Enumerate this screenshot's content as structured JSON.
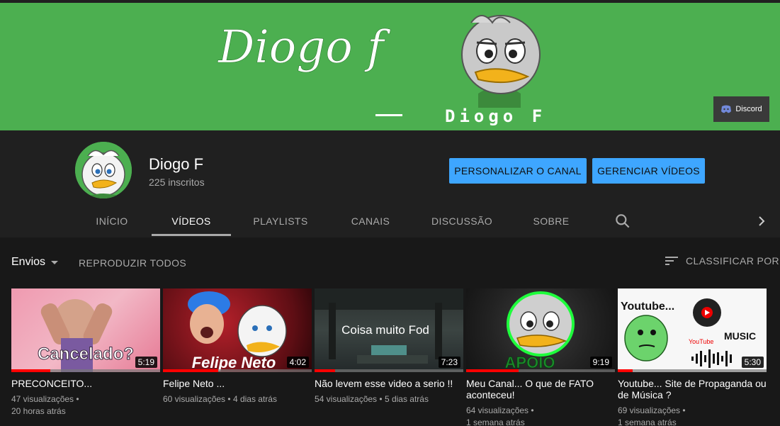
{
  "banner": {
    "script_text": "Diogo f",
    "name_text": "Diogo F",
    "discord_label": "Discord"
  },
  "channel": {
    "name": "Diogo F",
    "subscribers": "225 inscritos",
    "customize_label": "PERSONALIZAR O CANAL",
    "manage_label": "GERENCIAR VÍDEOS"
  },
  "tabs": [
    {
      "label": "INÍCIO"
    },
    {
      "label": "VÍDEOS"
    },
    {
      "label": "PLAYLISTS"
    },
    {
      "label": "CANAIS"
    },
    {
      "label": "DISCUSSÃO"
    },
    {
      "label": "SOBRE"
    }
  ],
  "toolbar": {
    "uploads_label": "Envios",
    "play_all_label": "REPRODUZIR TODOS",
    "sort_label": "CLASSIFICAR POR"
  },
  "videos": [
    {
      "title": "PRECONCEITO...",
      "meta": "47 visualizações • 20 horas atrás",
      "views": "47 visualizações •",
      "age": "20 horas atrás",
      "duration": "5:19",
      "thumb_text": "Cancelado?",
      "progress": 0.26
    },
    {
      "title": "Felipe Neto ...",
      "meta": "",
      "views": "60 visualizações •",
      "age": "4 dias atrás",
      "duration": "4:02",
      "thumb_text": "Felipe Neto",
      "progress": 0.37
    },
    {
      "title": "Não levem esse video a serio !!",
      "views": "54 visualizações •",
      "age": "5 dias atrás",
      "duration": "7:23",
      "thumb_text": "Coisa muito Fod",
      "progress": 0.14
    },
    {
      "title": "Meu Canal... O que de FATO aconteceu!",
      "views": "64 visualizações •",
      "age": "1 semana atrás",
      "duration": "9:19",
      "thumb_text": "APOIO",
      "progress": 0.35
    },
    {
      "title": "Youtube... Site de Propaganda ou de Música ?",
      "views": "69 visualizações •",
      "age": "1 semana atrás",
      "duration": "5:30",
      "thumb_text": "Youtube...",
      "thumb_text2": "MUSIC",
      "progress": 0.1
    }
  ],
  "colors": {
    "banner_green": "#4caf50",
    "accent_blue": "#3ea6ff",
    "progress_red": "#ff0000"
  }
}
